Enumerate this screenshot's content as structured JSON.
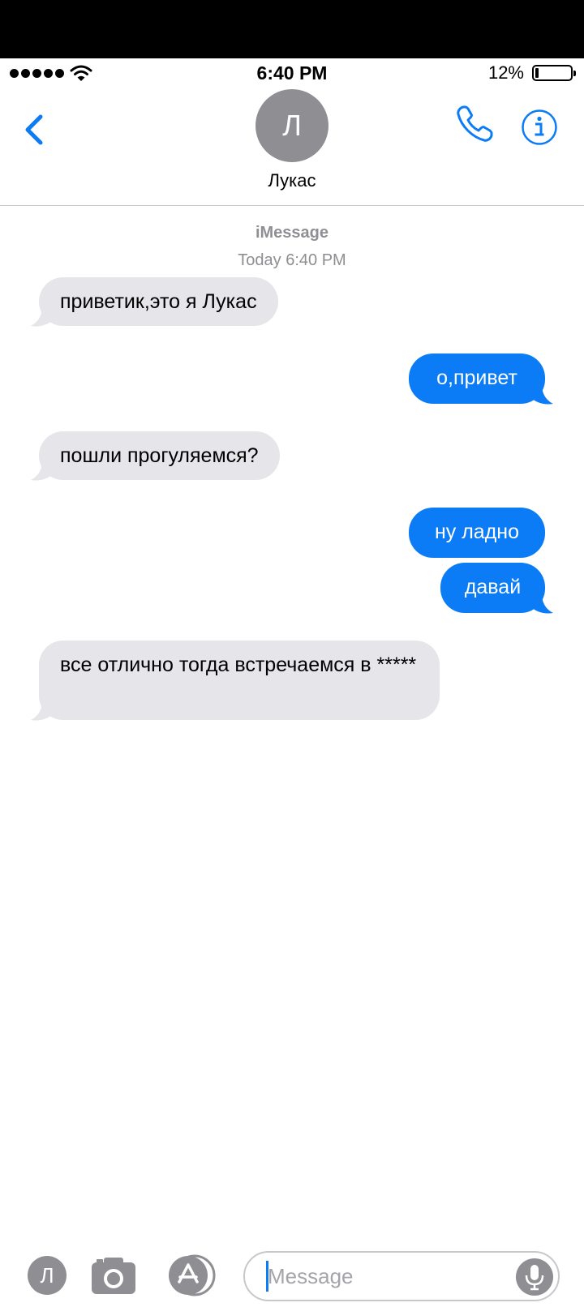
{
  "status_bar": {
    "time": "6:40 PM",
    "battery_percent": "12%",
    "battery_level": 0.12,
    "signal_icon": "signal-dots-icon",
    "wifi_icon": "wifi-icon"
  },
  "header": {
    "contact_initial": "Л",
    "contact_name": "Лукас",
    "back_icon": "chevron-left-icon",
    "call_icon": "phone-icon",
    "info_icon": "info-icon"
  },
  "conversation": {
    "service": "iMessage",
    "timestamp": "Today 6:40 PM",
    "messages": [
      {
        "direction": "incoming",
        "text": "приветик,это я Лукас"
      },
      {
        "direction": "outgoing",
        "text": "о,привет"
      },
      {
        "direction": "incoming",
        "text": "пошли прогуляемся?"
      },
      {
        "direction": "outgoing",
        "text": "ну ладно"
      },
      {
        "direction": "outgoing",
        "text": "давай"
      },
      {
        "direction": "incoming",
        "text": "все отлично тогда встречаемся в *****"
      }
    ]
  },
  "composer": {
    "avatar_initial": "Л",
    "placeholder": "Message",
    "camera_icon": "camera-icon",
    "appstore_icon": "app-store-icon",
    "mic_icon": "microphone-icon"
  },
  "colors": {
    "accent_blue": "#0b7cf5",
    "incoming_bubble": "#e5e5ea",
    "gray": "#8e8e93"
  }
}
